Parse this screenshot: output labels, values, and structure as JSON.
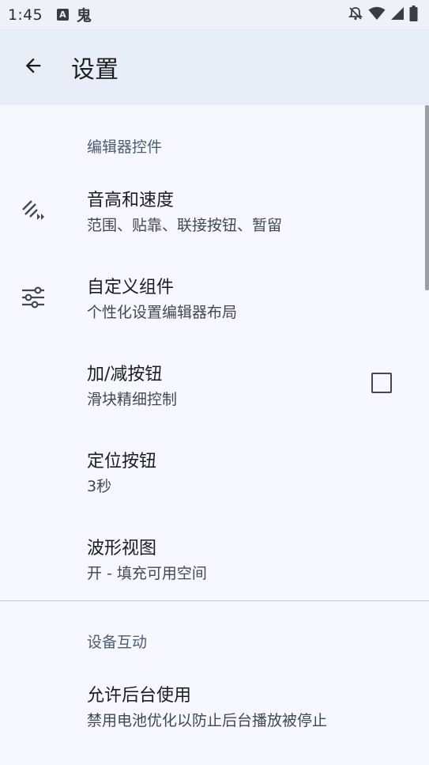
{
  "status_bar": {
    "time": "1:45",
    "notif_a": "A",
    "notif_b": "鬼"
  },
  "app_bar": {
    "title": "设置"
  },
  "sections": {
    "editor": {
      "header": "编辑器控件"
    },
    "device": {
      "header": "设备互动"
    }
  },
  "prefs": {
    "pitch": {
      "title": "音高和速度",
      "summary": "范围、贴靠、联接按钮、暂留",
      "icon": "tune-pitch-icon"
    },
    "custom": {
      "title": "自定义组件",
      "summary": "个性化设置编辑器布局",
      "icon": "sliders-icon"
    },
    "plusminus": {
      "title": "加/减按钮",
      "summary": "滑块精细控制",
      "checked": false
    },
    "locate": {
      "title": "定位按钮",
      "summary": "3秒"
    },
    "waveform": {
      "title": "波形视图",
      "summary": "开 - 填充可用空间"
    },
    "background": {
      "title": "允许后台使用",
      "summary": "禁用电池优化以防止后台播放被停止"
    }
  },
  "colors": {
    "background": "#f7f8ff",
    "app_bar": "#e8eef8",
    "section_header": "#4b5d73"
  }
}
